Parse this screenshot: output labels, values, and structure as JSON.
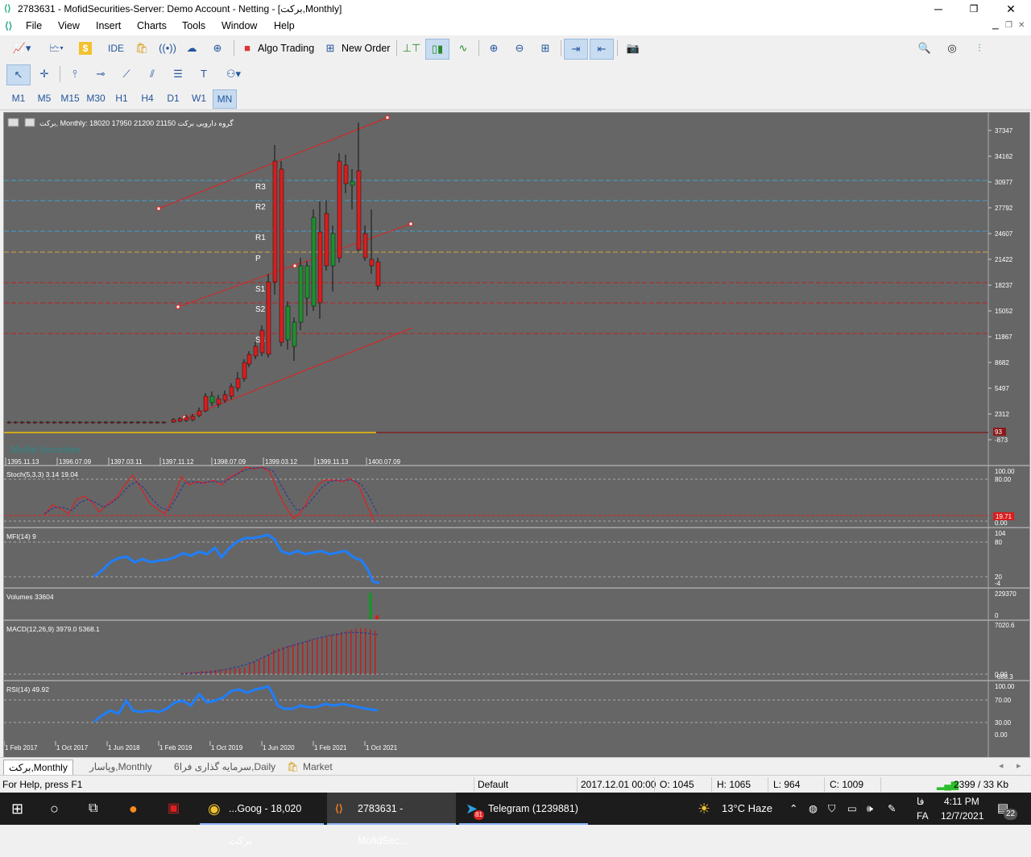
{
  "window": {
    "title": "2783631 - MofidSecurities-Server: Demo Account - Netting - [برکت,Monthly]",
    "min_glyph": "─",
    "max_glyph": "❐",
    "close_glyph": "✕"
  },
  "menu": [
    "File",
    "View",
    "Insert",
    "Charts",
    "Tools",
    "Window",
    "Help"
  ],
  "toolbar": {
    "ide": "IDE",
    "algo_trading": "Algo Trading",
    "new_order": "New Order"
  },
  "timeframes": [
    "M1",
    "M5",
    "M15",
    "M30",
    "H1",
    "H4",
    "D1",
    "W1",
    "MN"
  ],
  "active_timeframe": "MN",
  "chart": {
    "header": "برکت, Monthly:  18020  17950  21200  21150   گروه دارویی برکت",
    "watermark": "Mofid Securities",
    "price_ticks": [
      "37347",
      "34162",
      "30977",
      "27792",
      "24607",
      "21422",
      "18237",
      "15052",
      "11867",
      "8682",
      "5497",
      "2312",
      "-873"
    ],
    "price_marker": "93",
    "pivot_labels": [
      "R3",
      "R2",
      "R1",
      "P",
      "S1",
      "S2",
      "S3"
    ],
    "top_date_ticks": [
      "1395.11.13",
      "1396.07.09",
      "1397.03.11",
      "1397.11.12",
      "1398.07.09",
      "1399.03.12",
      "1399.11.13",
      "1400.07.09"
    ],
    "bottom_date_ticks": [
      "1 Feb 2017",
      "1 Oct 2017",
      "1 Jun 2018",
      "1 Feb 2019",
      "1 Oct 2019",
      "1 Jun 2020",
      "1 Feb 2021",
      "1 Oct 2021"
    ],
    "colors": {
      "bg": "#666666",
      "bull": "#1f8f2f",
      "bear": "#d81e1e",
      "channel": "#e02020",
      "pivot_r": "#3fa0d0",
      "pivot_p": "#e0a040",
      "pivot_s": "#c02020",
      "indicator": "#1e7fff"
    }
  },
  "indicators": {
    "stoch": {
      "label": "Stoch(5,3,3) 3.14 19.04",
      "ticks": [
        "100.00",
        "80.00",
        "20.00",
        "0.00"
      ],
      "marker": "19.71"
    },
    "mfi": {
      "label": "MFI(14) 9",
      "ticks": [
        "104",
        "80",
        "20",
        "-4"
      ]
    },
    "volumes": {
      "label": "Volumes 33604",
      "ticks": [
        "229370",
        "0"
      ]
    },
    "macd": {
      "label": "MACD(12,26,9) 3979.0 5368.1",
      "ticks": [
        "7020.6",
        "0.00",
        "-688.3"
      ]
    },
    "rsi": {
      "label": "RSI(14) 49.92",
      "ticks": [
        "100.00",
        "70.00",
        "30.00",
        "0.00"
      ]
    }
  },
  "tabs": [
    {
      "label": "برکت,Monthly",
      "active": true
    },
    {
      "label": "وپاسار,Monthly",
      "active": false
    },
    {
      "label": "سرمایه گذاری فرا6,Daily",
      "active": false
    },
    {
      "label": "Market",
      "active": false
    }
  ],
  "status": {
    "help": "For Help, press F1",
    "profile": "Default",
    "datetime": "2017.12.01 00:00",
    "open": "O: 1045",
    "high": "H: 1065",
    "low": "L: 964",
    "close": "C: 1009",
    "traffic": "2399 / 33 Kb"
  },
  "taskbar": {
    "chrome": "...Goog - 18,020 برکت",
    "mt5": "2783631 - MofidSec...",
    "telegram": "Telegram (1239881)",
    "telegram_badge": "81",
    "weather": "13°C  Haze",
    "lang": "فا",
    "lang2": "FA",
    "time": "4:11 PM",
    "date": "12/7/2021",
    "notif": "22"
  }
}
